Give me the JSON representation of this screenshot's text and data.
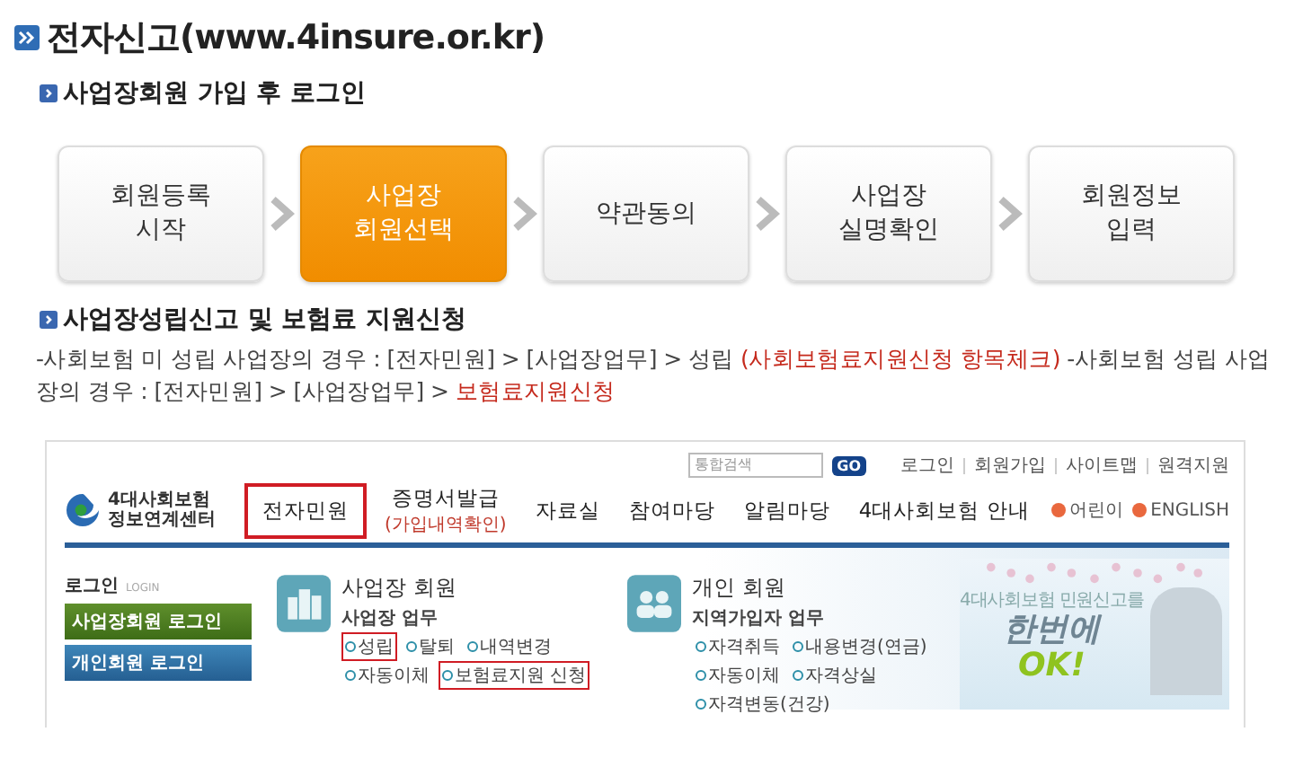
{
  "title": "전자신고(www.4insure.or.kr)",
  "login_section": {
    "heading": "사업장회원 가입 후 로그인",
    "steps": [
      {
        "label": "회원등록\n시작",
        "selected": false
      },
      {
        "label": "사업장\n회원선택",
        "selected": true
      },
      {
        "label": "약관동의",
        "selected": false
      },
      {
        "label": "사업장\n실명확인",
        "selected": false
      },
      {
        "label": "회원정보\n입력",
        "selected": false
      }
    ]
  },
  "report_section": {
    "heading": "사업장성립신고 및 보험료 지원신청",
    "paragraph": [
      {
        "text": "-사회보험 미 성립 사업장의 경우 : [전자민원] > [사업장업무] > 성립 ",
        "emphasis": false
      },
      {
        "text": "(사회보험료지원신청 항목체크)",
        "emphasis": true
      },
      {
        "text": " -사회보험 성립 사업장의 경우 : [전자민원] > [사업장업무] > ",
        "emphasis": false
      },
      {
        "text": "보험료지원신청",
        "emphasis": true
      }
    ]
  },
  "screenshot": {
    "search": {
      "placeholder": "통합검색",
      "button": "GO"
    },
    "top_links": [
      "로그인",
      "회원가입",
      "사이트맵",
      "원격지원"
    ],
    "logo_text": "4대사회보험\n정보연계센터",
    "nav": [
      {
        "label": "전자민원",
        "highlighted": true
      },
      {
        "label": "증명서발급",
        "sub": "(가입내역확인)",
        "highlighted": false
      },
      {
        "label": "자료실",
        "highlighted": false
      },
      {
        "label": "참여마당",
        "highlighted": false
      },
      {
        "label": "알림마당",
        "highlighted": false
      },
      {
        "label": "4대사회보험 안내",
        "highlighted": false
      }
    ],
    "lang_links": [
      "어린이",
      "ENGLISH"
    ],
    "login": {
      "label": "로그인",
      "label_en": "LOGIN",
      "buttons": [
        {
          "label": "사업장회원 로그인",
          "kind": "business"
        },
        {
          "label": "개인회원 로그인",
          "kind": "personal"
        }
      ]
    },
    "cards": [
      {
        "title": "사업장 회원",
        "kind": "business",
        "subtitle": "사업장 업무",
        "items": [
          {
            "label": "성립",
            "highlighted": true
          },
          {
            "label": "탈퇴",
            "highlighted": false
          },
          {
            "label": "내역변경",
            "highlighted": false
          },
          {
            "label": "자동이체",
            "highlighted": false
          },
          {
            "label": "보험료지원 신청",
            "highlighted": true
          }
        ]
      },
      {
        "title": "개인 회원",
        "kind": "personal",
        "subtitle": "지역가입자 업무",
        "items": [
          {
            "label": "자격취득",
            "highlighted": false
          },
          {
            "label": "내용변경(연금)",
            "highlighted": false
          },
          {
            "label": "자동이체",
            "highlighted": false
          },
          {
            "label": "자격상실",
            "highlighted": false
          },
          {
            "label": "자격변동(건강)",
            "highlighted": false
          }
        ]
      }
    ],
    "banner": {
      "caption": "4대사회보험 민원신고를",
      "headline": "한번에",
      "accent": "OK!"
    }
  }
}
